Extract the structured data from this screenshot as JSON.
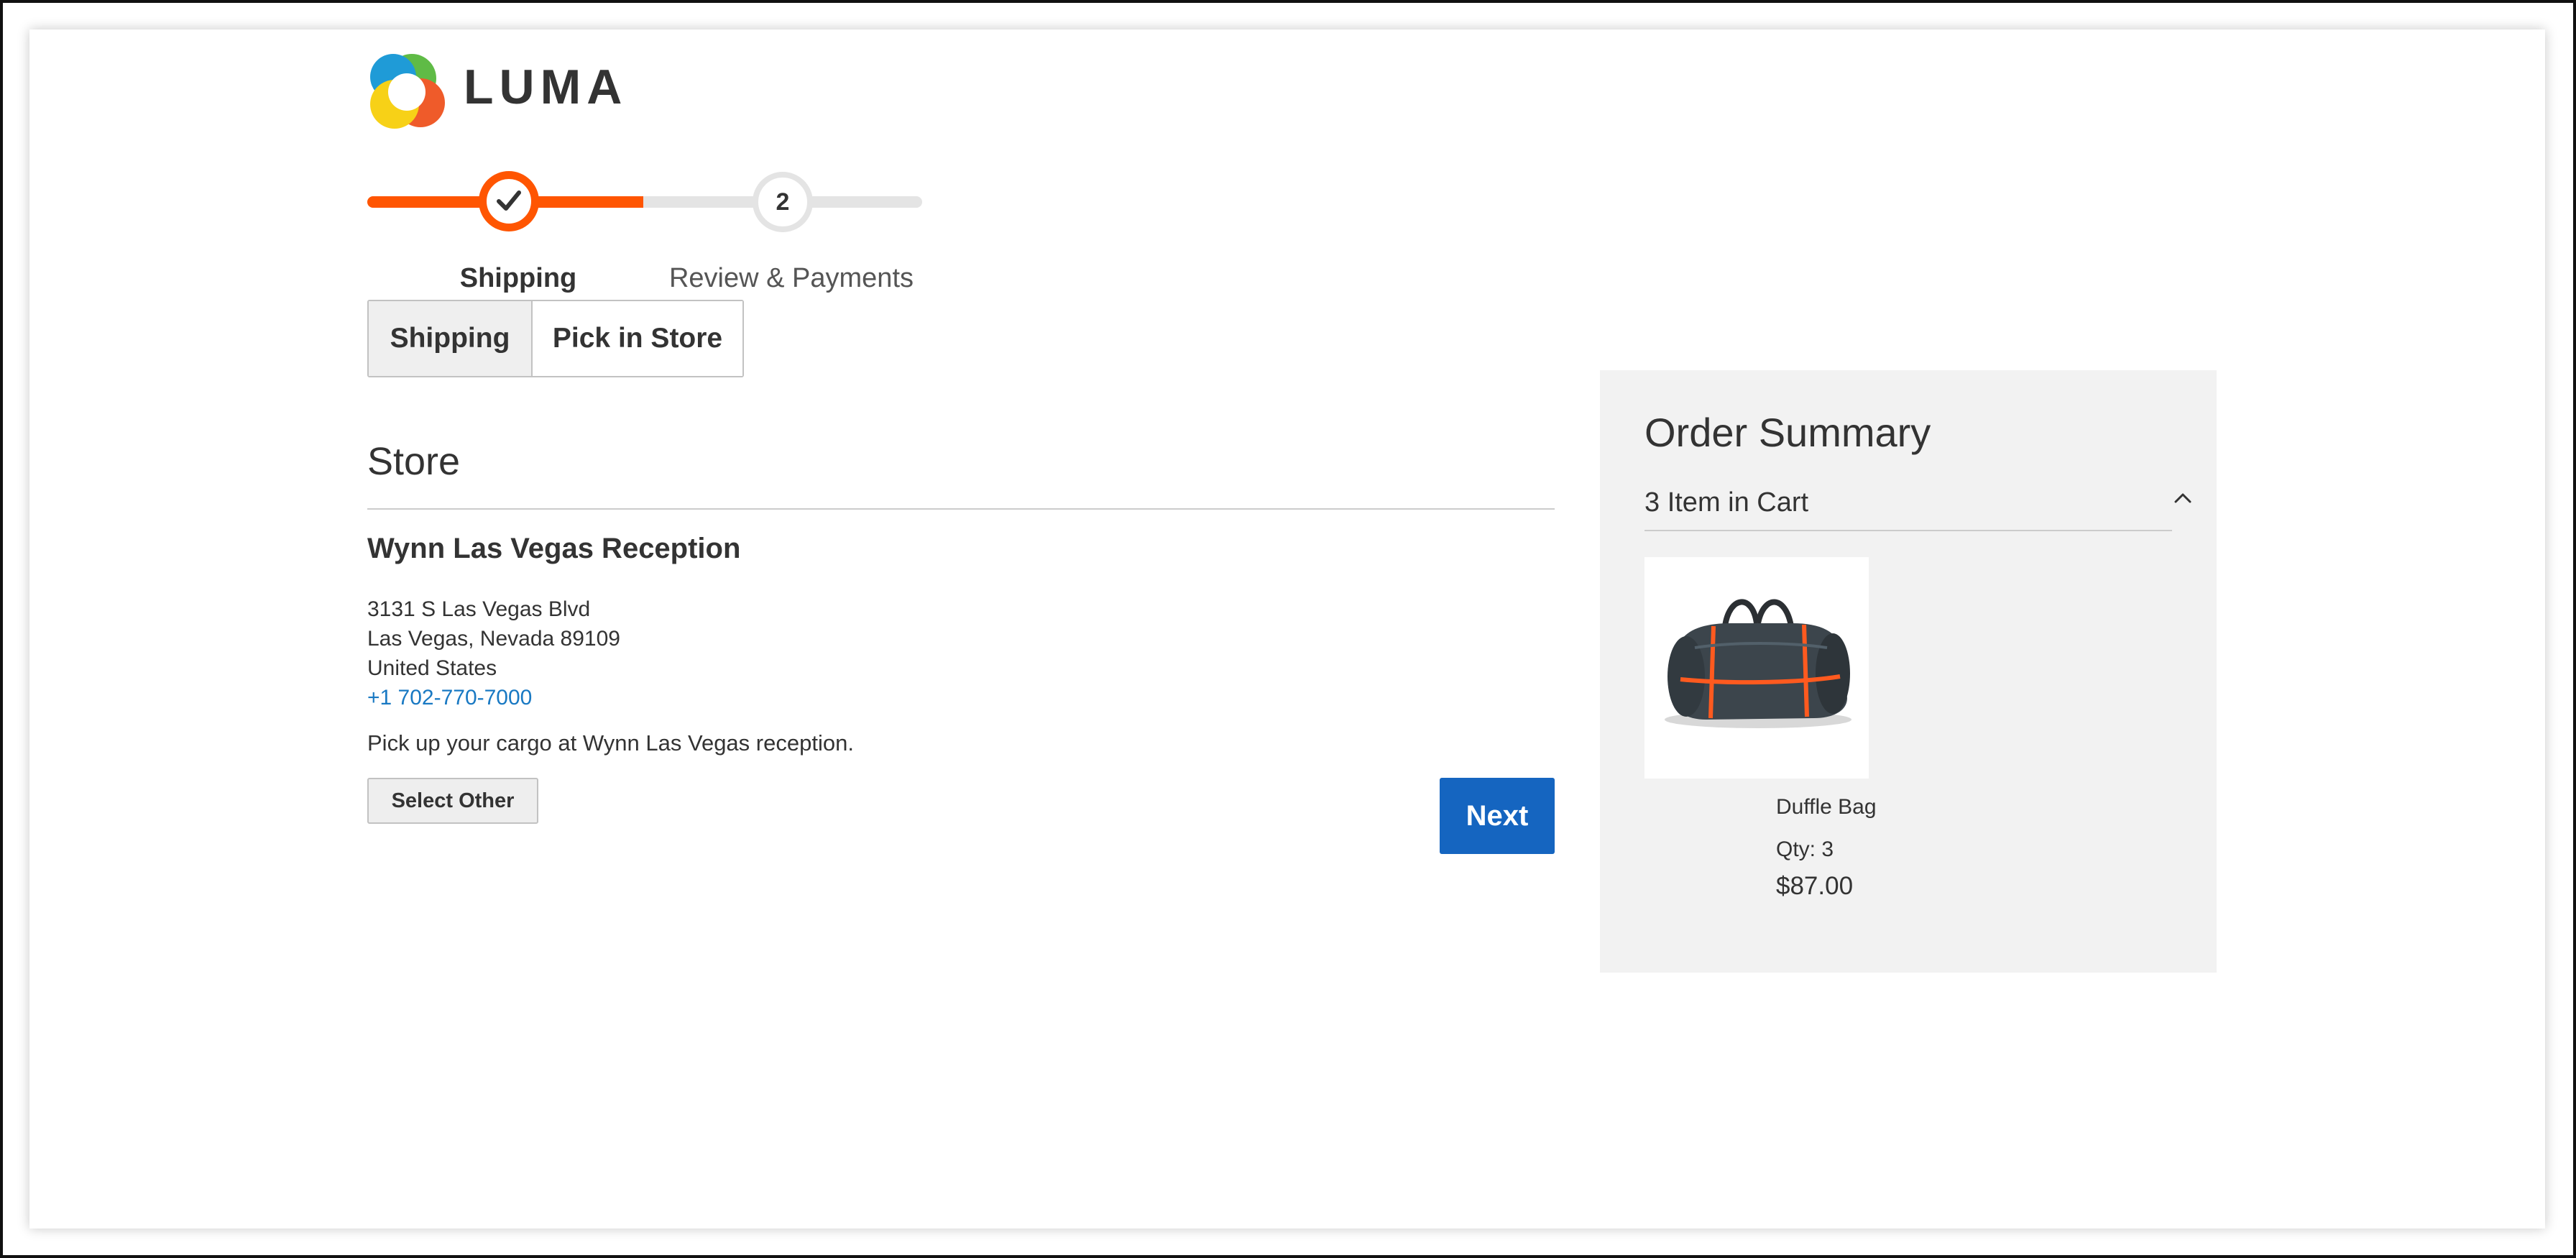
{
  "brand": {
    "name": "LUMA"
  },
  "progress": {
    "steps": [
      {
        "number": "1",
        "label": "Shipping",
        "status": "complete"
      },
      {
        "number": "2",
        "label": "Review & Payments",
        "status": "upcoming"
      }
    ],
    "completed_fraction": 0.5
  },
  "tabs": [
    {
      "label": "Shipping",
      "active": true
    },
    {
      "label": "Pick in Store",
      "active": false
    }
  ],
  "store": {
    "heading": "Store",
    "name": "Wynn Las Vegas Reception",
    "address_line1": "3131 S Las Vegas Blvd",
    "address_line2": "Las Vegas, Nevada 89109",
    "country": "United States",
    "phone": "+1 702-770-7000",
    "note": "Pick up your cargo at Wynn Las Vegas reception.",
    "select_other_label": "Select Other"
  },
  "next_label": "Next",
  "summary": {
    "title": "Order Summary",
    "cart_count": "3 Item in Cart",
    "items": [
      {
        "name": "Duffle Bag",
        "qty": "Qty: 3",
        "price": "$87.00",
        "image_icon": "duffle-bag-image"
      }
    ]
  },
  "colors": {
    "accent": "#ff5501",
    "primary_button": "#1565c0",
    "link": "#1979c3",
    "summary_background": "#f2f2f2"
  }
}
